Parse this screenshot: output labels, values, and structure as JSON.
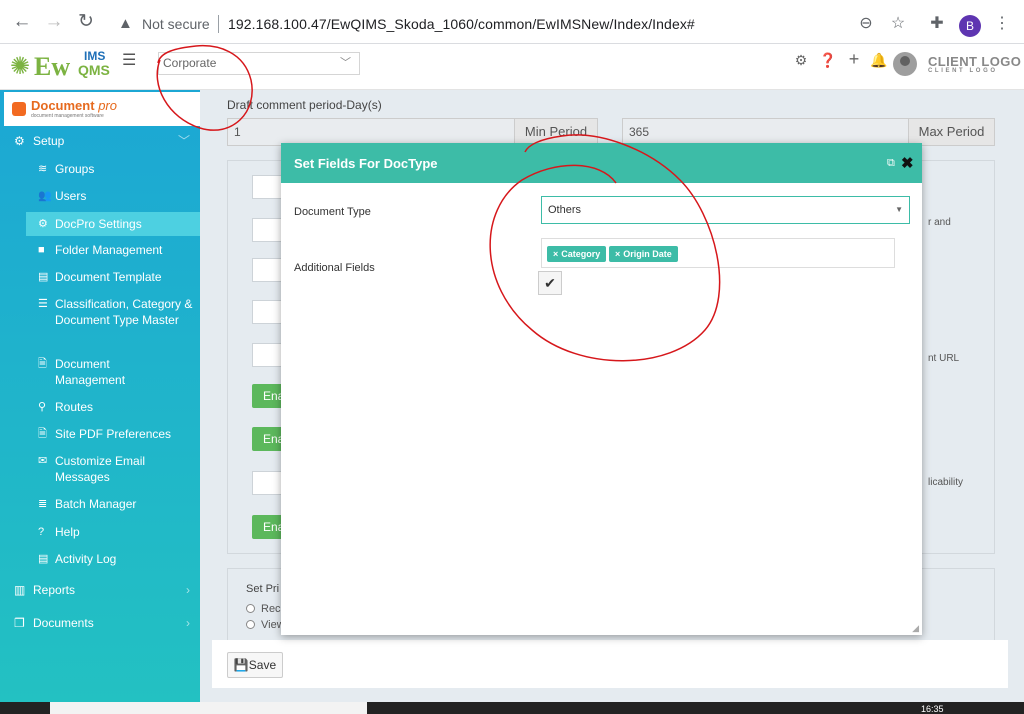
{
  "browser": {
    "security": "Not secure",
    "url": "192.168.100.47/EwQIMS_Skoda_1060/common/EwIMSNew/Index/Index#",
    "avatar_letter": "B"
  },
  "header": {
    "logo_ew": "Ew",
    "logo_ims": "IMS",
    "logo_qms": "QMS",
    "corporate": "Corporate",
    "client_logo": "CLIENT LOGO",
    "client_logo_sub": "CLIENT LOGO"
  },
  "sidebar": {
    "brand": "Document",
    "brand_suffix": "pro",
    "brand_tag": "document management software",
    "setup": "Setup",
    "items": [
      {
        "label": "Groups"
      },
      {
        "label": "Users"
      },
      {
        "label": "DocPro Settings"
      },
      {
        "label": "Folder Management"
      },
      {
        "label": "Document Template"
      },
      {
        "label": "Classification, Category & Document Type Master"
      },
      {
        "label": "Document Management"
      },
      {
        "label": "Routes"
      },
      {
        "label": "Site PDF Preferences"
      },
      {
        "label": "Customize Email Messages"
      },
      {
        "label": "Batch Manager"
      },
      {
        "label": "Help"
      },
      {
        "label": "Activity Log"
      }
    ],
    "reports": "Reports",
    "documents": "Documents"
  },
  "main": {
    "draft_label": "Draft comment period-Day(s)",
    "min_value": "1",
    "min_addon": "Min Period",
    "max_value": "365",
    "max_addon": "Max Period",
    "enable_text": "Ena",
    "side_text_1": "r and",
    "side_text_2": "nt URL",
    "side_text_3": "licability",
    "privilege_label": "Set Pri",
    "radio_1": "Rec",
    "radio_2": "View",
    "save": "Save"
  },
  "modal": {
    "title": "Set Fields For DocType",
    "doc_type_label": "Document Type",
    "doc_type_value": "Others",
    "additional_label": "Additional Fields",
    "tags": [
      "Category",
      "Origin Date"
    ]
  },
  "taskbar": {
    "clock": "16:35"
  },
  "colors": {
    "accent": "#3dbca7",
    "sidebar_top": "#1ca7d4",
    "sidebar_bottom": "#23c1c2",
    "annotation": "#d6171b"
  }
}
